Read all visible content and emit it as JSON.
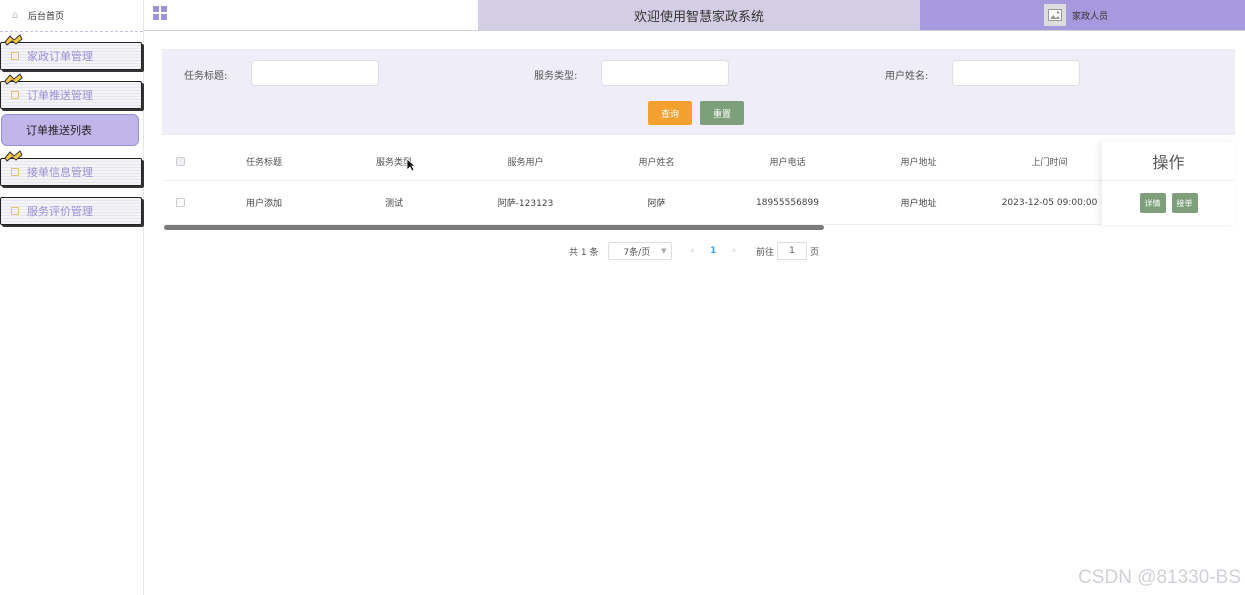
{
  "sidebar": {
    "home": "后台首页",
    "groups": [
      {
        "label": "家政订单管理"
      },
      {
        "label": "订单推送管理"
      },
      {
        "label": "接单信息管理"
      },
      {
        "label": "服务评价管理"
      }
    ],
    "submenu": "订单推送列表"
  },
  "header": {
    "welcome": "欢迎使用智慧家政系统",
    "user": "家政人员"
  },
  "filter": {
    "task_title_label": "任务标题:",
    "service_type_label": "服务类型:",
    "user_name_label": "用户姓名:",
    "search_button": "查询",
    "reset_button": "重置"
  },
  "table": {
    "headers": [
      "任务标题",
      "服务类型",
      "服务用户",
      "用户姓名",
      "用户电话",
      "用户地址",
      "上门时间",
      "操作"
    ],
    "rows": [
      {
        "cells": [
          "用户添加",
          "测试",
          "阿萨-123123",
          "阿萨",
          "18955556899",
          "用户地址",
          "2023-12-05 09:00:00"
        ],
        "actions": [
          "详情",
          "接单"
        ]
      }
    ]
  },
  "pager": {
    "total": "共 1 条",
    "page_size": "7条/页",
    "prev": "‹",
    "current": "1",
    "next": "›",
    "goto": "前往",
    "goto_value": "1",
    "page_unit": "页"
  },
  "watermark": "CSDN @81330-BS",
  "colors": {
    "accent": "#a799de",
    "search_button": "#f3a02f",
    "reset_button": "#7da07b",
    "active_page": "#409eff"
  }
}
